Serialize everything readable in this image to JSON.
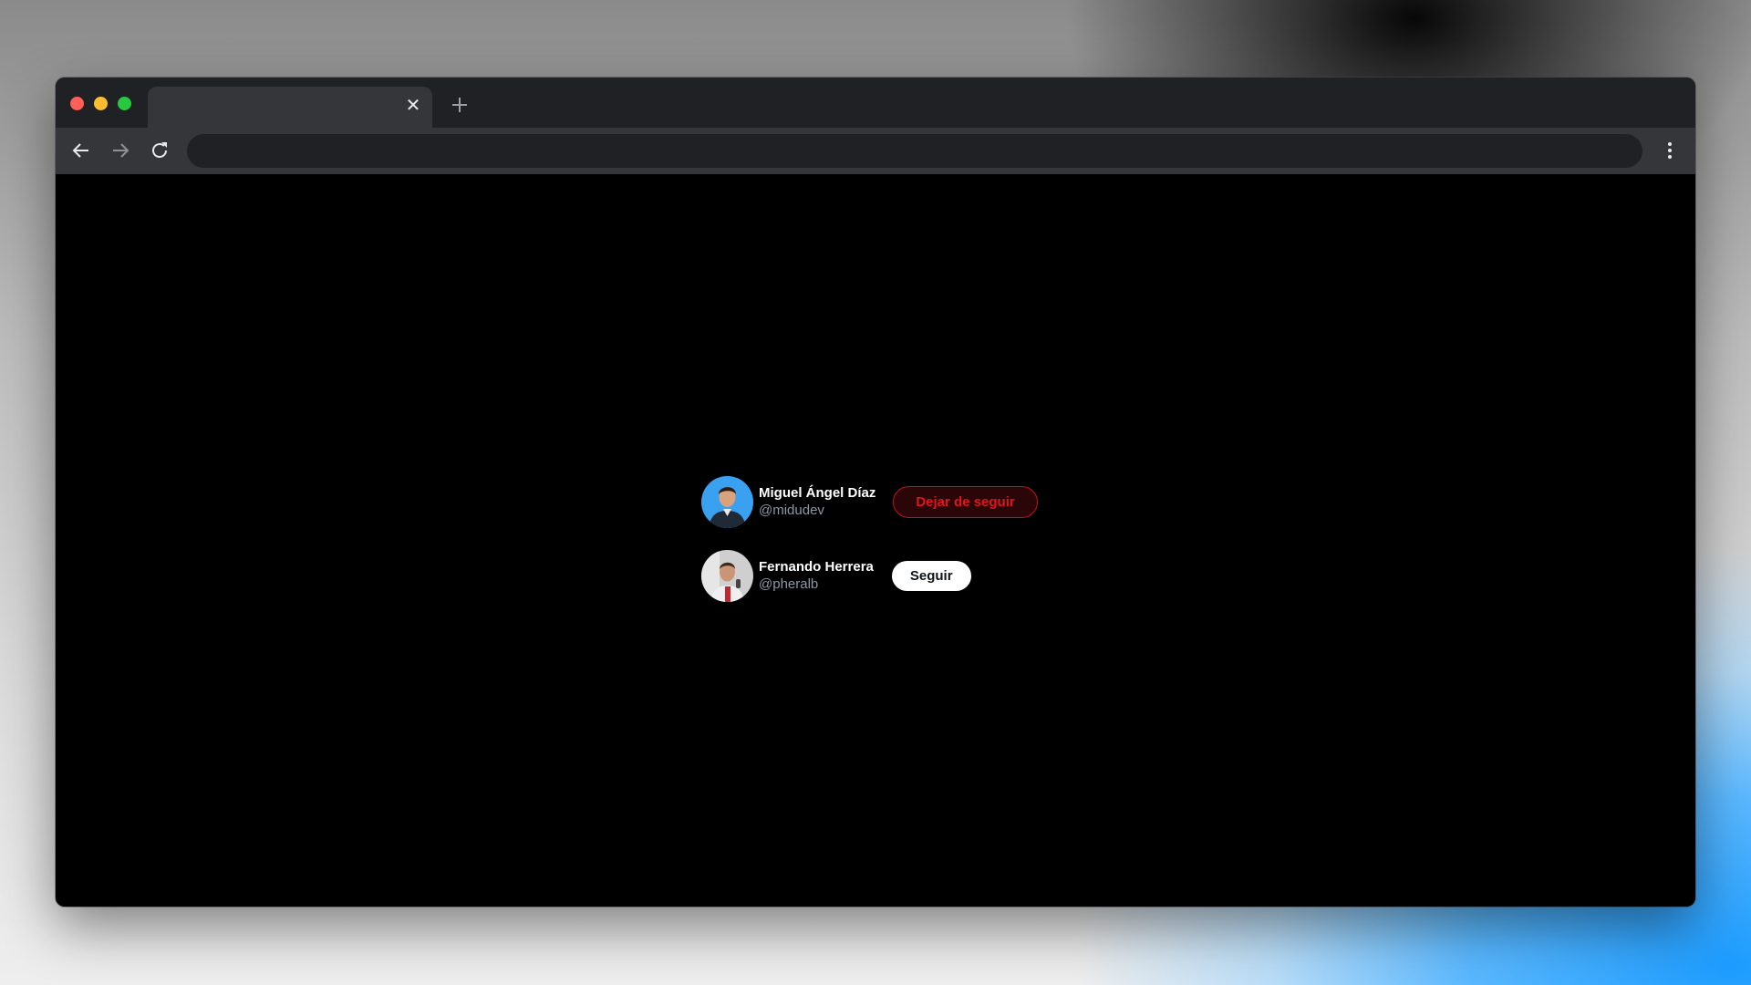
{
  "browser": {
    "tab": {
      "title": "",
      "close_icon": "close-icon",
      "close_glyph": "✕"
    },
    "new_tab_icon": "plus-icon",
    "nav": {
      "back_icon": "arrow-left-icon",
      "forward_icon": "arrow-right-icon",
      "reload_icon": "reload-icon",
      "menu_icon": "vertical-dots-icon"
    },
    "address_bar": {
      "value": "",
      "placeholder": ""
    },
    "traffic_lights": {
      "close_color": "#ff5f57",
      "minimize_color": "#febc2e",
      "maximize_color": "#28c840"
    }
  },
  "page": {
    "background": "#000000",
    "follow_cards": [
      {
        "name": "Miguel Ángel Díaz",
        "handle": "@midudev",
        "button_label": "Dejar de seguir",
        "is_following": true,
        "avatar_icon": "user-avatar"
      },
      {
        "name": "Fernando Herrera",
        "handle": "@pheralb",
        "button_label": "Seguir",
        "is_following": false,
        "avatar_icon": "user-avatar"
      }
    ]
  },
  "colors": {
    "unfollow_red": "#e0141e",
    "handle_gray": "#8b98a5",
    "follow_button_bg": "#ffffff"
  }
}
